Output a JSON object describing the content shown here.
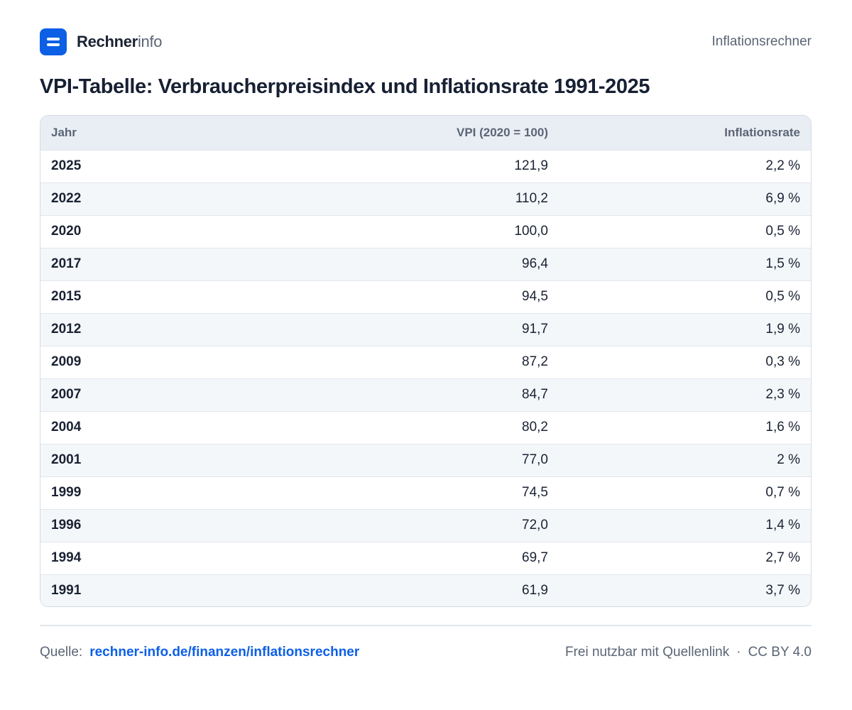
{
  "header": {
    "brand_strong": "Rechner",
    "brand_light": "info",
    "right_label": "Inflationsrechner"
  },
  "title": "VPI-Tabelle: Verbraucherpreisindex und Inflationsrate 1991-2025",
  "table": {
    "columns": [
      "Jahr",
      "VPI (2020 = 100)",
      "Inflationsrate"
    ],
    "rows": [
      {
        "year": "2025",
        "vpi": "121,9",
        "rate": "2,2 %"
      },
      {
        "year": "2022",
        "vpi": "110,2",
        "rate": "6,9 %"
      },
      {
        "year": "2020",
        "vpi": "100,0",
        "rate": "0,5 %"
      },
      {
        "year": "2017",
        "vpi": "96,4",
        "rate": "1,5 %"
      },
      {
        "year": "2015",
        "vpi": "94,5",
        "rate": "0,5 %"
      },
      {
        "year": "2012",
        "vpi": "91,7",
        "rate": "1,9 %"
      },
      {
        "year": "2009",
        "vpi": "87,2",
        "rate": "0,3 %"
      },
      {
        "year": "2007",
        "vpi": "84,7",
        "rate": "2,3 %"
      },
      {
        "year": "2004",
        "vpi": "80,2",
        "rate": "1,6 %"
      },
      {
        "year": "2001",
        "vpi": "77,0",
        "rate": "2 %"
      },
      {
        "year": "1999",
        "vpi": "74,5",
        "rate": "0,7 %"
      },
      {
        "year": "1996",
        "vpi": "72,0",
        "rate": "1,4 %"
      },
      {
        "year": "1994",
        "vpi": "69,7",
        "rate": "2,7 %"
      },
      {
        "year": "1991",
        "vpi": "61,9",
        "rate": "3,7 %"
      }
    ]
  },
  "footer": {
    "source_label": "Quelle:",
    "source_link": "rechner-info.de/finanzen/inflationsrechner",
    "license_text": "Frei nutzbar mit Quellenlink",
    "separator": "·",
    "license_name": "CC BY 4.0"
  },
  "colors": {
    "accent": "#0d5fe6",
    "text_dark": "#1a2233",
    "text_muted": "#5b6575",
    "header_bg": "#e9eef4",
    "row_alt_bg": "#f4f7fa"
  },
  "icons": {
    "logo": "menu-lines-icon"
  }
}
